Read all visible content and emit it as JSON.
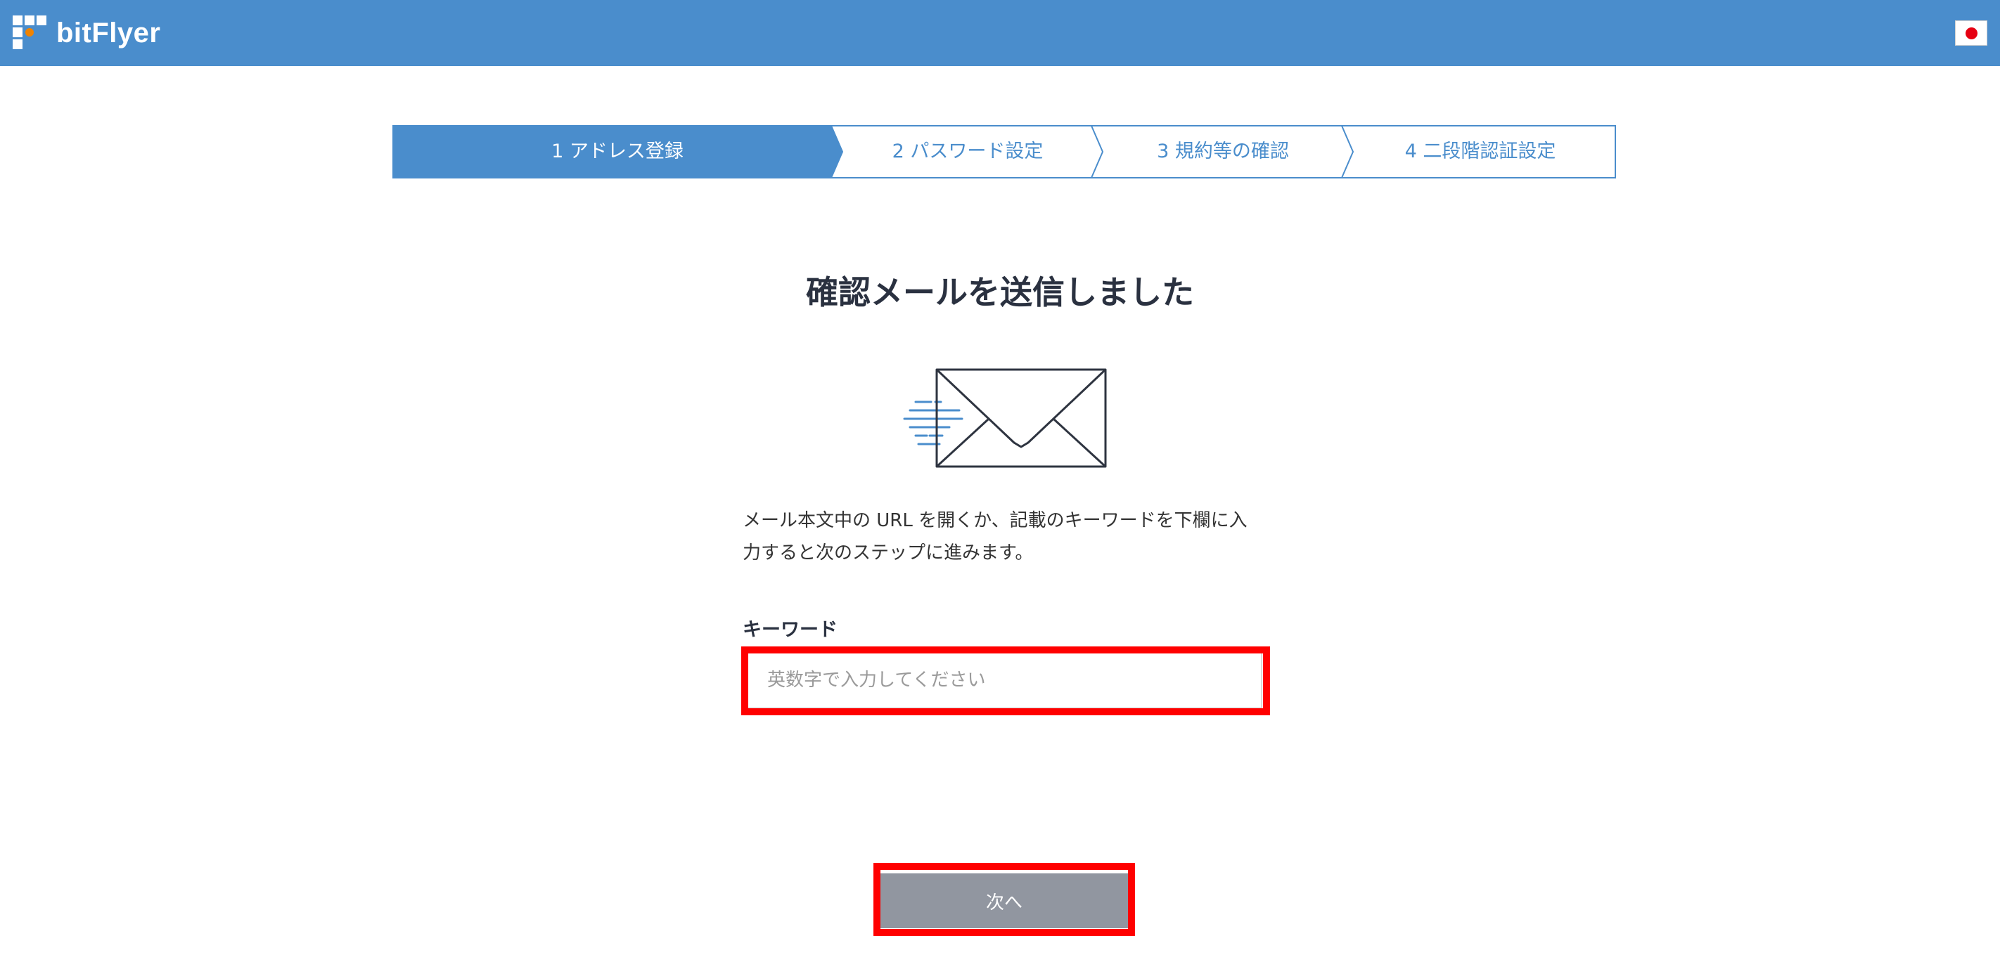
{
  "header": {
    "logo_text": "bitFlyer",
    "language_flag": "japan-flag-icon"
  },
  "steps": [
    {
      "label": "1 アドレス登録",
      "active": true
    },
    {
      "label": "2 パスワード設定",
      "active": false
    },
    {
      "label": "3 規約等の確認",
      "active": false
    },
    {
      "label": "4 二段階認証設定",
      "active": false
    }
  ],
  "main": {
    "title": "確認メールを送信しました",
    "icon": "envelope-icon",
    "description_line1": "メール本文中の URL を開くか、記載のキーワードを下欄に入",
    "description_line2": "力すると次のステップに進みます。",
    "keyword_label": "キーワード",
    "keyword_placeholder": "英数字で入力してください",
    "keyword_value": "",
    "next_button": "次へ"
  },
  "colors": {
    "header_bg": "#4a8dcc",
    "step_active_bg": "#4a8dcc",
    "step_text": "#4a8dcc",
    "button_disabled_bg": "#9196a0",
    "highlight": "#ff0000",
    "logo_accent": "#f08300"
  }
}
